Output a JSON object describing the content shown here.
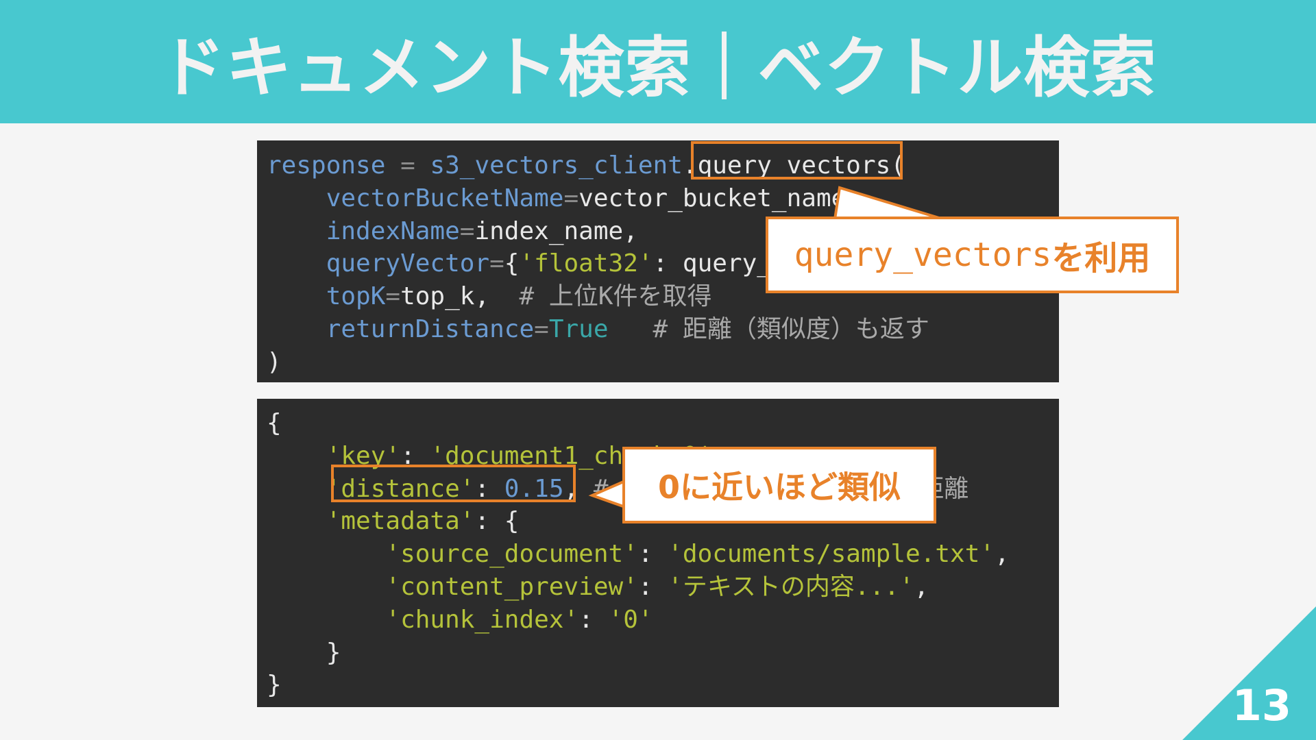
{
  "slide": {
    "title": "ドキュメント検索｜ベクトル検索",
    "page_number": "13"
  },
  "code_block_1": {
    "lines": [
      [
        {
          "t": "response",
          "c": "kw"
        },
        {
          "t": " = ",
          "c": "op"
        },
        {
          "t": "s3_vectors_client",
          "c": "kw"
        },
        {
          "t": ".query_vectors",
          "c": "pl"
        },
        {
          "t": "(",
          "c": "pl"
        }
      ],
      [
        {
          "t": "    vectorBucketName",
          "c": "kw"
        },
        {
          "t": "=",
          "c": "op"
        },
        {
          "t": "vector_bucket_name,",
          "c": "pl"
        }
      ],
      [
        {
          "t": "    indexName",
          "c": "kw"
        },
        {
          "t": "=",
          "c": "op"
        },
        {
          "t": "index_name,",
          "c": "pl"
        }
      ],
      [
        {
          "t": "    queryVector",
          "c": "kw"
        },
        {
          "t": "=",
          "c": "op"
        },
        {
          "t": "{",
          "c": "pl"
        },
        {
          "t": "'float32'",
          "c": "str"
        },
        {
          "t": ": query_embedding},",
          "c": "pl"
        }
      ],
      [
        {
          "t": "    topK",
          "c": "kw"
        },
        {
          "t": "=",
          "c": "op"
        },
        {
          "t": "top_k,",
          "c": "pl"
        },
        {
          "t": "  # 上位K件を取得",
          "c": "cmt"
        }
      ],
      [
        {
          "t": "    returnDistance",
          "c": "kw"
        },
        {
          "t": "=",
          "c": "op"
        },
        {
          "t": "True",
          "c": "kt"
        },
        {
          "t": "   # 距離（類似度）も返す",
          "c": "cmt"
        }
      ],
      [
        {
          "t": ")",
          "c": "pl"
        }
      ]
    ]
  },
  "code_block_2": {
    "lines": [
      [
        {
          "t": "{",
          "c": "pl"
        }
      ],
      [
        {
          "t": "    'key'",
          "c": "str"
        },
        {
          "t": ": ",
          "c": "pl"
        },
        {
          "t": "'document1_chunk_0'",
          "c": "str"
        },
        {
          "t": ",",
          "c": "pl"
        }
      ],
      [
        {
          "t": "    'distance'",
          "c": "str"
        },
        {
          "t": ": ",
          "c": "pl"
        },
        {
          "t": "0.15",
          "c": "num"
        },
        {
          "t": ",",
          "c": "pl"
        },
        {
          "t": " # コサイン類似度に基づいた距離",
          "c": "cmt"
        }
      ],
      [
        {
          "t": "    'metadata'",
          "c": "str"
        },
        {
          "t": ": {",
          "c": "pl"
        }
      ],
      [
        {
          "t": "        'source_document'",
          "c": "str"
        },
        {
          "t": ": ",
          "c": "pl"
        },
        {
          "t": "'documents/sample.txt'",
          "c": "str"
        },
        {
          "t": ",",
          "c": "pl"
        }
      ],
      [
        {
          "t": "        'content_preview'",
          "c": "str"
        },
        {
          "t": ": ",
          "c": "pl"
        },
        {
          "t": "'テキストの内容...'",
          "c": "str"
        },
        {
          "t": ",",
          "c": "pl"
        }
      ],
      [
        {
          "t": "        'chunk_index'",
          "c": "str"
        },
        {
          "t": ": ",
          "c": "pl"
        },
        {
          "t": "'0'",
          "c": "str"
        }
      ],
      [
        {
          "t": "    }",
          "c": "pl"
        }
      ],
      [
        {
          "t": "}",
          "c": "pl"
        }
      ]
    ]
  },
  "callout_1": {
    "mono_part": "query_vectors",
    "text_part": "を利用"
  },
  "callout_2": {
    "text": "0に近いほど類似"
  },
  "colors": {
    "header_bg": "#48c8cf",
    "accent_orange": "#e8822a",
    "code_bg": "#2c2c2c"
  }
}
